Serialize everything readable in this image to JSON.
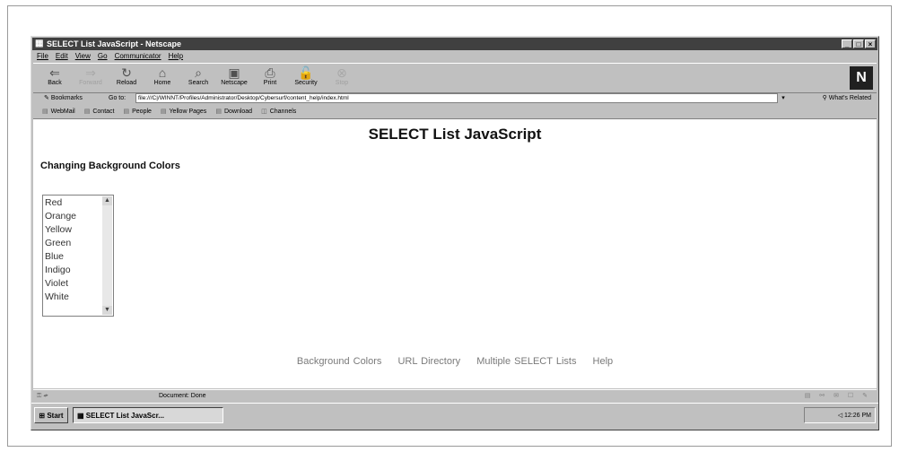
{
  "window": {
    "title": "SELECT List JavaScript - Netscape",
    "controls": {
      "minimize": "_",
      "maximize": "□",
      "close": "×"
    }
  },
  "menu": [
    "File",
    "Edit",
    "View",
    "Go",
    "Communicator",
    "Help"
  ],
  "toolbar": {
    "back": "Back",
    "forward": "Forward",
    "reload": "Reload",
    "home": "Home",
    "search": "Search",
    "netscape": "Netscape",
    "print": "Print",
    "security": "Security",
    "stop": "Stop"
  },
  "location": {
    "bookmarks": "Bookmarks",
    "goto_label": "Go to:",
    "url": "file:///C|/WINNT/Profiles/Administrator/Desktop/Cybersurf/content_help/index.html",
    "related": "What's Related"
  },
  "personal": [
    "WebMail",
    "Contact",
    "People",
    "Yellow Pages",
    "Download",
    "Channels"
  ],
  "page": {
    "heading": "SELECT List JavaScript",
    "subheading": "Changing Background Colors",
    "colors": [
      "Red",
      "Orange",
      "Yellow",
      "Green",
      "Blue",
      "Indigo",
      "Violet",
      "White"
    ],
    "links": [
      "Background Colors",
      "URL Directory",
      "Multiple SELECT Lists",
      "Help"
    ]
  },
  "status": {
    "text": "Document: Done"
  },
  "taskbar": {
    "start": "Start",
    "task": "SELECT List JavaScr...",
    "clock": "12:26 PM"
  }
}
